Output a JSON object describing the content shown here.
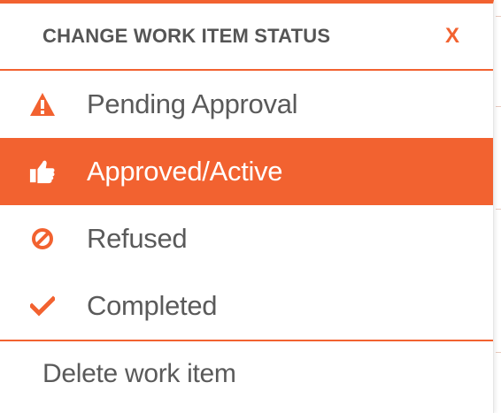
{
  "theme": {
    "accent": "#f26230",
    "active_text": "#ffffff"
  },
  "header": {
    "title": "CHANGE WORK ITEM STATUS",
    "close_label": "X"
  },
  "status_items": [
    {
      "label": "Pending Approval",
      "icon": "warning-icon",
      "active": false
    },
    {
      "label": "Approved/Active",
      "icon": "thumbs-up-icon",
      "active": true
    },
    {
      "label": "Refused",
      "icon": "prohibited-icon",
      "active": false
    },
    {
      "label": "Completed",
      "icon": "checkmark-icon",
      "active": false
    }
  ],
  "delete": {
    "label": "Delete work item"
  }
}
